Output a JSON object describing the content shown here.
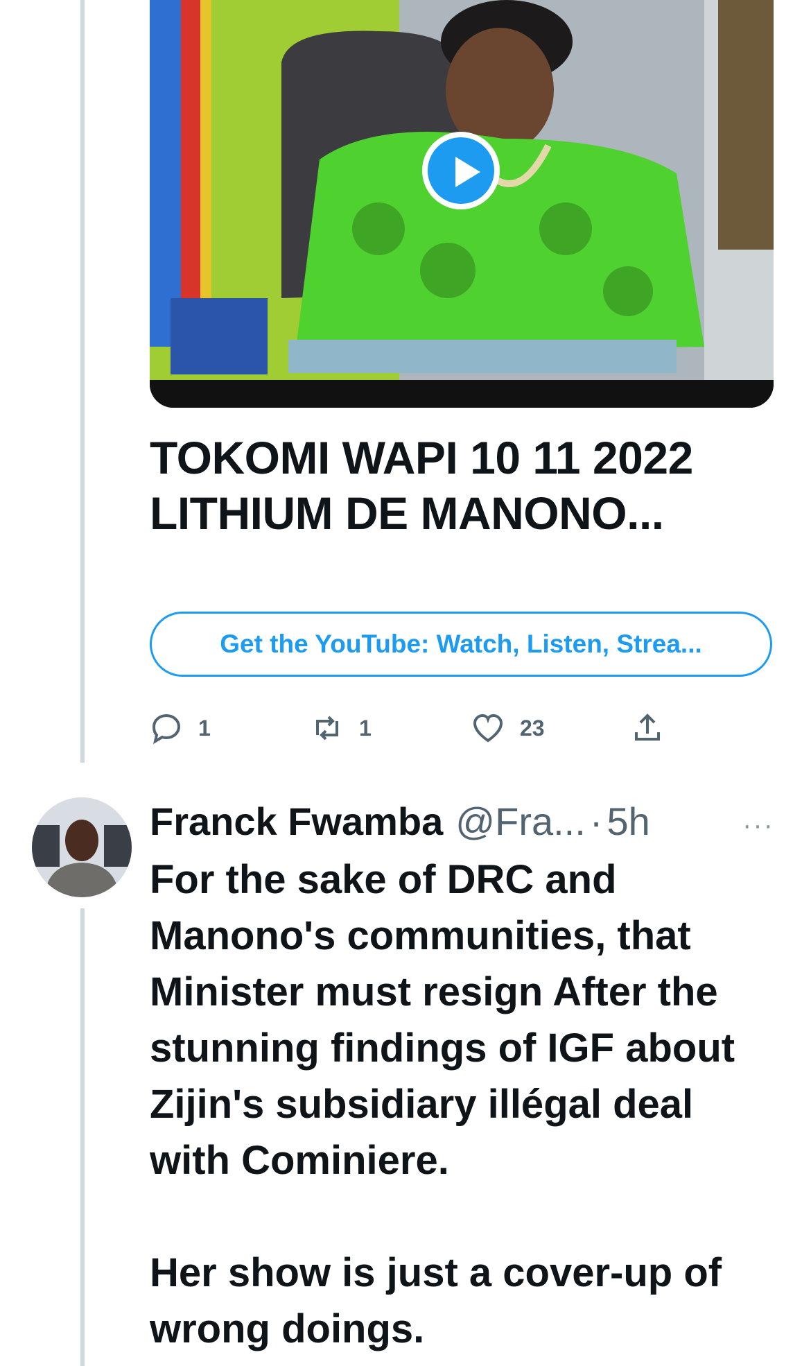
{
  "media": {
    "icon": "play-icon",
    "colors": {
      "play": "#1d9bf0",
      "dress": "#4fd12f",
      "wall": "#b8d43a"
    }
  },
  "card": {
    "title": "TOKOMI WAPI 10 11 2022 LITHIUM DE MANONO...",
    "link_label": "Get the YouTube: Watch, Listen, Strea..."
  },
  "actions": {
    "reply_count": "1",
    "retweet_count": "1",
    "like_count": "23"
  },
  "tweet": {
    "author_name": "Franck Fwamba",
    "handle": "@Fra...",
    "separator": "·",
    "time": "5h",
    "more": "···",
    "text": "For the sake of DRC and Manono's communities, that Minister must resign After the stunning findings of IGF about Zijin's subsidiary illégal deal with Cominiere.\n\nHer show is just a cover-up of wrong doings."
  },
  "colors": {
    "accent": "#1d9bf0",
    "text": "#0f1419",
    "muted": "#536471",
    "thread": "#cfd9de"
  }
}
